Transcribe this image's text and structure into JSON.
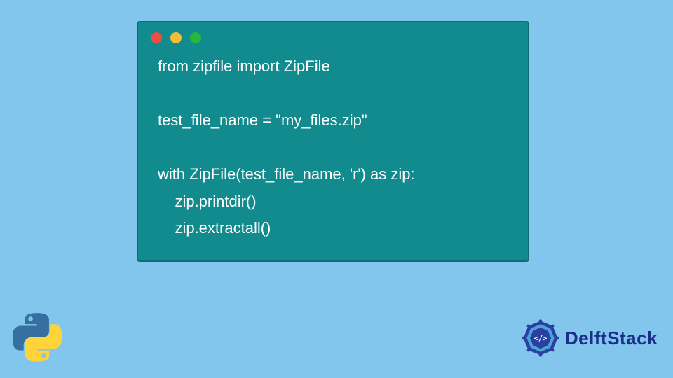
{
  "code": {
    "lines": [
      "from zipfile import ZipFile",
      "",
      "test_file_name = \"my_files.zip\"",
      "",
      "with ZipFile(test_file_name, 'r') as zip:",
      "    zip.printdir()",
      "    zip.extractall()"
    ]
  },
  "brand": {
    "name": "DelftStack"
  },
  "colors": {
    "background": "#82c6ed",
    "code_window": "#118b8e",
    "code_text": "#ffffff",
    "dot_red": "#ec5044",
    "dot_yellow": "#f2bd3c",
    "dot_green": "#25b83c",
    "brand_color": "#1b2f8a",
    "python_blue": "#3670a0",
    "python_yellow": "#ffd43b"
  }
}
